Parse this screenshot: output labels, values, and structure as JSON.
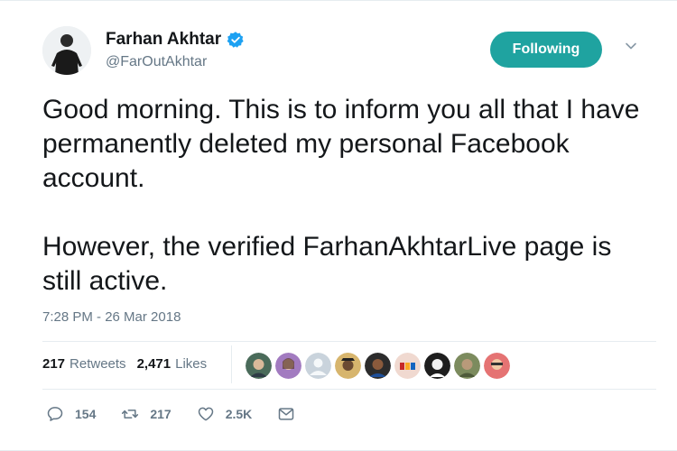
{
  "author": {
    "name": "Farhan Akhtar",
    "handle": "@FarOutAkhtar",
    "verified_icon": "verified-badge-icon"
  },
  "follow_button": {
    "label": "Following",
    "color": "#1fa3a0"
  },
  "tweet": {
    "text": "Good morning. This is to inform you all that I have permanently deleted my personal Facebook account.\n\nHowever, the verified FarhanAkhtarLive page is still active.",
    "timestamp": "7:28 PM - 26 Mar 2018"
  },
  "stats": {
    "retweets_count": "217",
    "retweets_label": "Retweets",
    "likes_count": "2,471",
    "likes_label": "Likes"
  },
  "actions": {
    "reply_count": "154",
    "retweet_count": "217",
    "like_count": "2.5K"
  },
  "colors": {
    "brand_accent": "#1da1f2",
    "text_primary": "#14171a",
    "text_secondary": "#657786",
    "divider": "#e6ecf0"
  }
}
